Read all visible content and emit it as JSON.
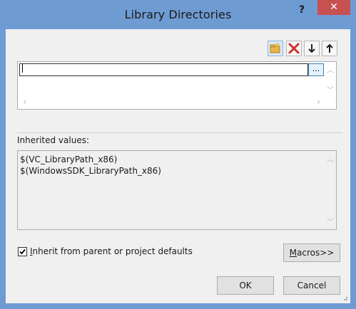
{
  "window": {
    "title": "Library Directories",
    "help_label": "?",
    "close_label": "✕"
  },
  "toolbar": {
    "icons": [
      "new-line-icon",
      "delete-icon",
      "move-down-icon",
      "move-up-icon"
    ]
  },
  "entry": {
    "value": "",
    "browse_label": "..."
  },
  "inherited": {
    "label": "Inherited values:",
    "values": [
      "$(VC_LibraryPath_x86)",
      "$(WindowsSDK_LibraryPath_x86)"
    ]
  },
  "inherit_checkbox": {
    "checked": true,
    "label_underlined": "I",
    "label_rest": "nherit from parent or project defaults"
  },
  "buttons": {
    "macros_underlined": "M",
    "macros_rest": "acros>>",
    "ok": "OK",
    "cancel": "Cancel"
  },
  "colors": {
    "titlebar": "#6f9bd3",
    "close": "#c75050",
    "dialog_bg": "#f0f0f0"
  }
}
